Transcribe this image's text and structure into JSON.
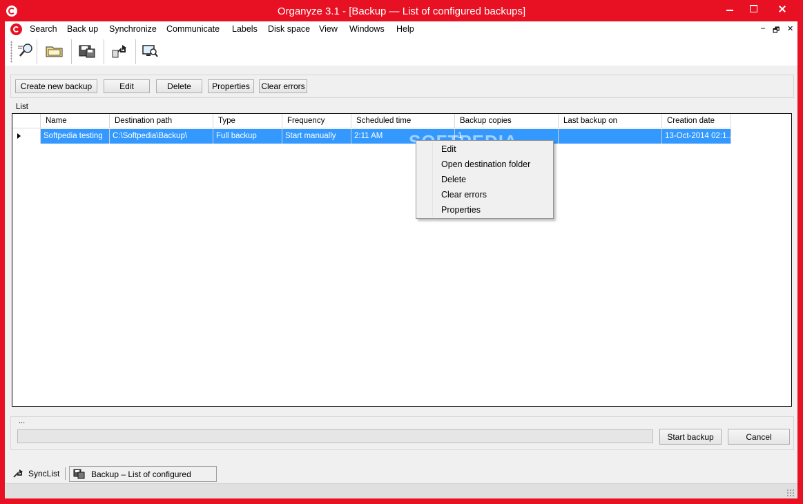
{
  "window": {
    "title": "Organyze 3.1 - [Backup — List of configured backups]"
  },
  "menu": [
    "Search",
    "Back up",
    "Synchronize",
    "Communicate",
    "Labels",
    "Disk space",
    "View",
    "Windows",
    "Help"
  ],
  "mdi_controls": [
    "–",
    "🗗",
    "✕"
  ],
  "toolbar": {
    "tools": [
      "search-tool-icon",
      "folder-tool-icon",
      "backup-disk-icon",
      "sync-arrows-icon",
      "monitor-search-icon"
    ]
  },
  "actions": {
    "create": "Create new backup",
    "edit": "Edit",
    "delete": "Delete",
    "properties": "Properties",
    "clear_errors": "Clear errors"
  },
  "list": {
    "label": "List",
    "columns": [
      "Name",
      "Destination path",
      "Type",
      "Frequency",
      "Scheduled time",
      "Backup copies",
      "Last backup on",
      "Creation date"
    ],
    "rows": [
      [
        "Softpedia testing",
        "C:\\Softpedia\\Backup\\",
        "Full backup",
        "Start manually",
        "2:11 AM",
        "1",
        "",
        "13-Oct-2014 02:1..."
      ]
    ]
  },
  "watermark": "SOFTPEDIA",
  "context_menu": [
    "Edit",
    "Open destination folder",
    "Delete",
    "Clear errors",
    "Properties"
  ],
  "progress": {
    "status_text": "...",
    "value": 0
  },
  "bottom": {
    "start": "Start backup",
    "cancel": "Cancel"
  },
  "tabs": [
    {
      "label": "SyncList",
      "icon": "sync-icon"
    },
    {
      "label": "Backup – List of configured backups",
      "icon": "backup-disk-icon"
    }
  ],
  "colors": {
    "title_bar": "#e81123",
    "selection": "#3399ff"
  }
}
